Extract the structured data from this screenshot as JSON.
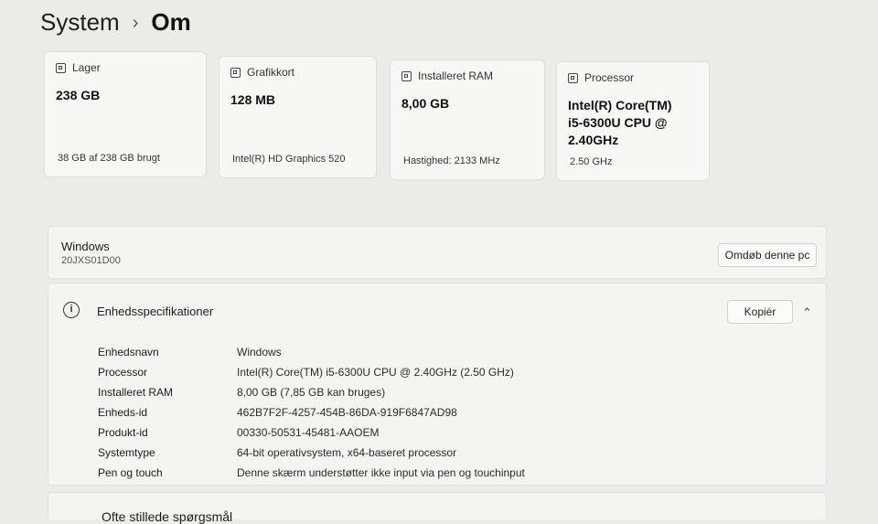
{
  "breadcrumb": {
    "parent": "System",
    "separator": "›",
    "current": "Om"
  },
  "cards": [
    {
      "icon": "storage-icon",
      "label": "Lager",
      "value": "238 GB",
      "sub": "38 GB af 238 GB brugt"
    },
    {
      "icon": "graphics-card-icon",
      "label": "Grafikkort",
      "value": "128 MB",
      "sub": "Intel(R) HD Graphics 520"
    },
    {
      "icon": "ram-icon",
      "label": "Installeret RAM",
      "value": "8,00 GB",
      "sub": "Hastighed: 2133 MHz"
    },
    {
      "icon": "processor-icon",
      "label": "Processor",
      "value": "Intel(R) Core(TM) i5-6300U CPU @ 2.40GHz",
      "sub": "2.50 GHz"
    }
  ],
  "device": {
    "name": "Windows",
    "model": "20JXS01D00",
    "rename_label": "Omdøb denne pc"
  },
  "specs": {
    "title": "Enhedsspecifikationer",
    "copy_label": "Kopiér",
    "collapse_glyph": "⌃",
    "info_glyph": "i",
    "rows": [
      {
        "label": "Enhedsnavn",
        "value": "Windows"
      },
      {
        "label": "Processor",
        "value": "Intel(R) Core(TM) i5-6300U CPU @ 2.40GHz (2.50 GHz)"
      },
      {
        "label": "Installeret RAM",
        "value": "8,00 GB (7,85 GB kan bruges)"
      },
      {
        "label": "Enheds-id",
        "value": "462B7F2F-4257-454B-86DA-919F6847AD98"
      },
      {
        "label": "Produkt-id",
        "value": "00330-50531-45481-AAOEM"
      },
      {
        "label": "Systemtype",
        "value": "64-bit operativsystem, x64-baseret processor"
      },
      {
        "label": "Pen og touch",
        "value": "Denne skærm understøtter ikke input via pen og touchinput"
      }
    ]
  },
  "faq": {
    "title": "Ofte stillede spørgsmål"
  }
}
